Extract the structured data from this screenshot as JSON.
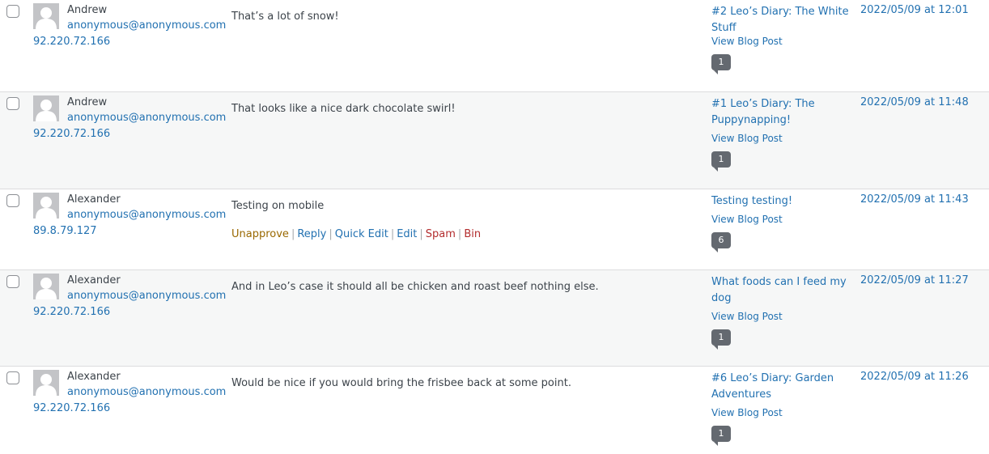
{
  "comments": [
    {
      "author": "Andrew",
      "email": "anonymous@anonymous.com",
      "ip": "92.220.72.166",
      "text": "That’s a lot of snow!",
      "post_title": "#2 Leo’s Diary: The White Stuff",
      "view_post": "View Blog Post",
      "count": "1",
      "date": "2022/05/09 at 12:01"
    },
    {
      "author": "Andrew",
      "email": "anonymous@anonymous.com",
      "ip": "92.220.72.166",
      "text": "That looks like a nice dark chocolate swirl!",
      "post_title": "#1 Leo’s Diary: The Puppynapping!",
      "view_post": "View Blog Post",
      "count": "1",
      "date": "2022/05/09 at 11:48"
    },
    {
      "author": "Alexander",
      "email": "anonymous@anonymous.com",
      "ip": "89.8.79.127",
      "text": "Testing on mobile",
      "post_title": "Testing testing!",
      "view_post": "View Blog Post",
      "count": "6",
      "date": "2022/05/09 at 11:43",
      "actions": {
        "unapprove": "Unapprove",
        "reply": "Reply",
        "quick_edit": "Quick Edit",
        "edit": "Edit",
        "spam": "Spam",
        "bin": "Bin",
        "separator": "|"
      }
    },
    {
      "author": "Alexander",
      "email": "anonymous@anonymous.com",
      "ip": "92.220.72.166",
      "text": "And in Leo’s case it should all be chicken and roast beef nothing else.",
      "post_title": "What foods can I feed my dog",
      "view_post": "View Blog Post",
      "count": "1",
      "date": "2022/05/09 at 11:27"
    },
    {
      "author": "Alexander",
      "email": "anonymous@anonymous.com",
      "ip": "92.220.72.166",
      "text": "Would be nice if you would bring the frisbee back at some point.",
      "post_title": "#6 Leo’s Diary: Garden Adventures",
      "view_post": "View Blog Post",
      "count": "1",
      "date": "2022/05/09 at 11:26"
    }
  ],
  "icons": {
    "avatar": "default-avatar-silhouette-icon",
    "count_badge": "comment-bubble-icon"
  },
  "colors": {
    "link": "#2271b1",
    "unapprove": "#996800",
    "danger": "#b32d2e",
    "badge": "#646970",
    "alt_row": "#f6f7f7"
  }
}
